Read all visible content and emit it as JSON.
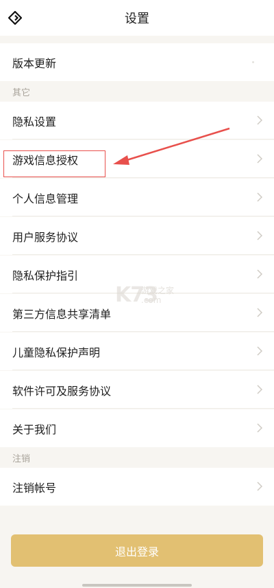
{
  "header": {
    "title": "设置",
    "back_icon": "back-diamond-icon"
  },
  "rows": [
    {
      "id": "version-update",
      "label": "版本更新",
      "chevron": false
    },
    {
      "id": "privacy-settings",
      "label": "隐私设置",
      "chevron": true
    },
    {
      "id": "game-info-auth",
      "label": "游戏信息授权",
      "chevron": true
    },
    {
      "id": "personal-info",
      "label": "个人信息管理",
      "chevron": true
    },
    {
      "id": "user-agreement",
      "label": "用户服务协议",
      "chevron": true
    },
    {
      "id": "privacy-guide",
      "label": "隐私保护指引",
      "chevron": true
    },
    {
      "id": "third-party",
      "label": "第三方信息共享清单",
      "chevron": true
    },
    {
      "id": "child-privacy",
      "label": "儿童隐私保护声明",
      "chevron": true
    },
    {
      "id": "software-license",
      "label": "软件许可及服务协议",
      "chevron": true
    },
    {
      "id": "about-us",
      "label": "关于我们",
      "chevron": true
    },
    {
      "id": "cancel-account",
      "label": "注销帐号",
      "chevron": true
    }
  ],
  "sections": {
    "other": "其它",
    "cancel": "注销"
  },
  "logout_label": "退出登录",
  "watermark": {
    "main": "K73",
    "sub1": "游戏之家",
    "sub2": ".com"
  },
  "colors": {
    "accent": "#e2c072",
    "annotation": "#e8504c",
    "background": "#f7f5f1"
  }
}
